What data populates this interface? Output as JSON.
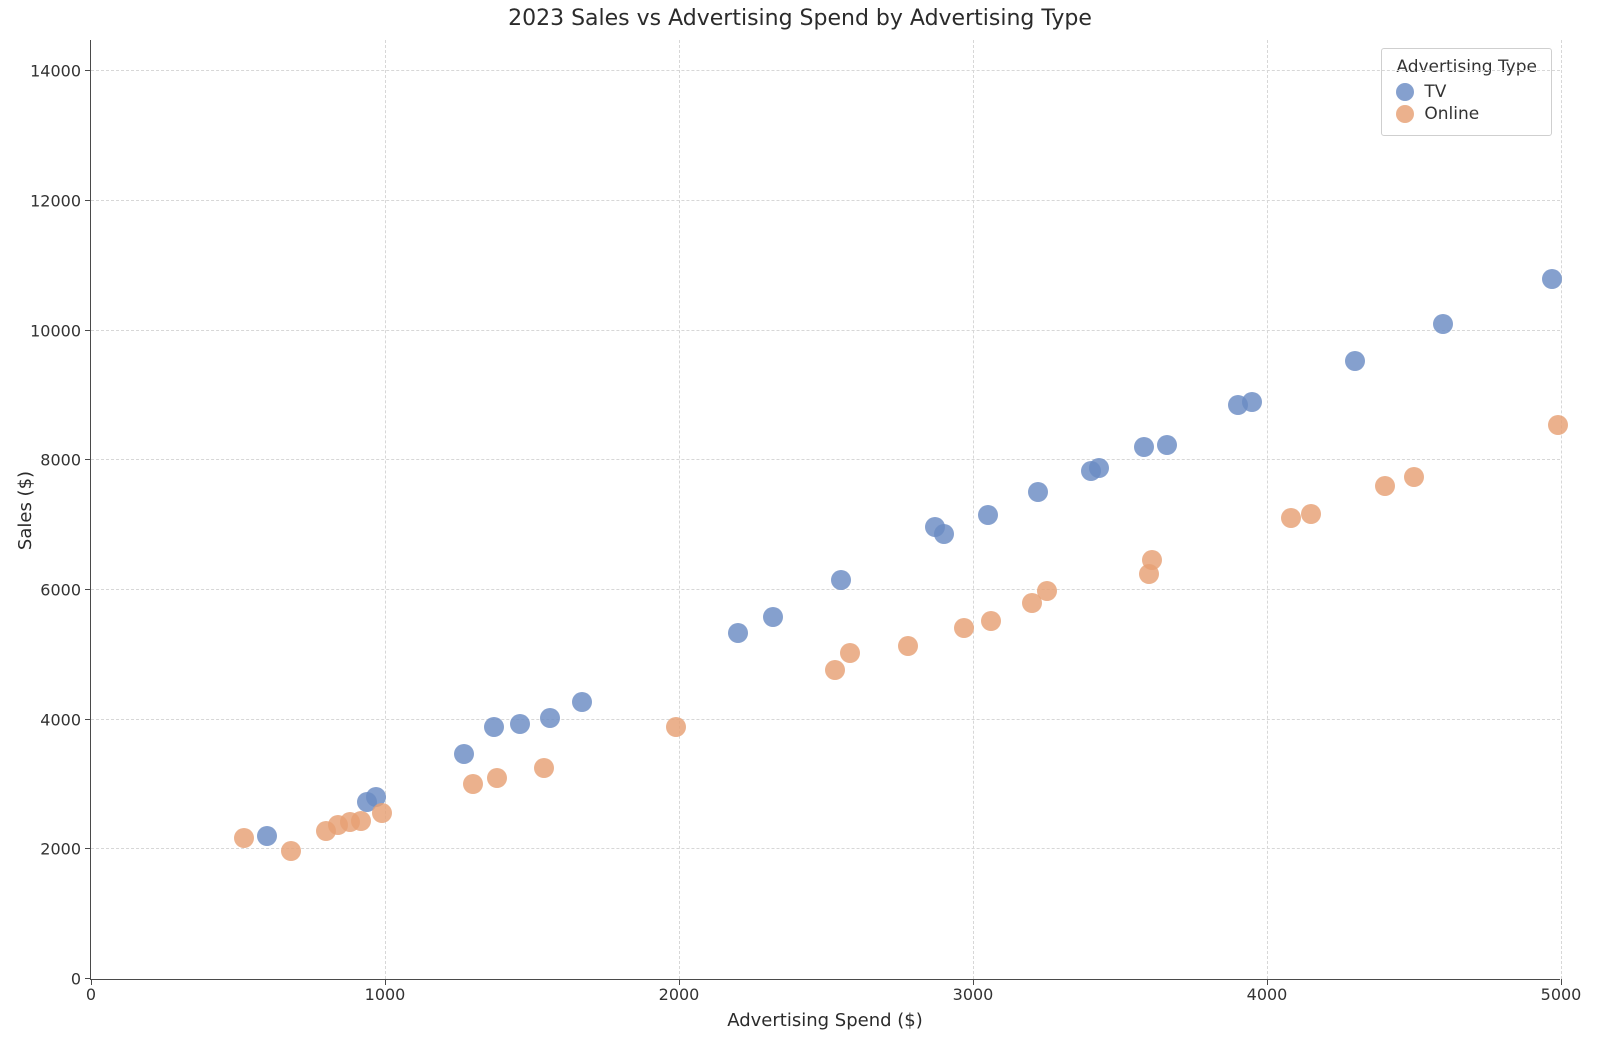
{
  "chart_data": {
    "type": "scatter",
    "title": "2023 Sales vs Advertising Spend by Advertising Type",
    "xlabel": "Advertising Spend ($)",
    "ylabel": "Sales ($)",
    "xlim": [
      0,
      5000
    ],
    "ylim": [
      0,
      14500
    ],
    "xticks": [
      0,
      1000,
      2000,
      3000,
      4000,
      5000
    ],
    "yticks": [
      0,
      2000,
      4000,
      6000,
      8000,
      10000,
      12000,
      14000
    ],
    "legend_title": "Advertising Type",
    "legend_position": "upper right",
    "grid": true,
    "colors": {
      "TV": "#6a8bc3",
      "Online": "#e6a074"
    },
    "series": [
      {
        "name": "TV",
        "points": [
          {
            "x": 600,
            "y": 2200
          },
          {
            "x": 940,
            "y": 2730
          },
          {
            "x": 970,
            "y": 2800
          },
          {
            "x": 1270,
            "y": 3470
          },
          {
            "x": 1370,
            "y": 3880
          },
          {
            "x": 1460,
            "y": 3930
          },
          {
            "x": 1560,
            "y": 4020
          },
          {
            "x": 1670,
            "y": 4270
          },
          {
            "x": 2200,
            "y": 5340
          },
          {
            "x": 2320,
            "y": 5580
          },
          {
            "x": 2550,
            "y": 6160
          },
          {
            "x": 2870,
            "y": 6980
          },
          {
            "x": 2900,
            "y": 6870
          },
          {
            "x": 3050,
            "y": 7160
          },
          {
            "x": 3220,
            "y": 7520
          },
          {
            "x": 3400,
            "y": 7830
          },
          {
            "x": 3430,
            "y": 7880
          },
          {
            "x": 3580,
            "y": 8200
          },
          {
            "x": 3660,
            "y": 8230
          },
          {
            "x": 3900,
            "y": 8850
          },
          {
            "x": 3950,
            "y": 8900
          },
          {
            "x": 4300,
            "y": 9530
          },
          {
            "x": 4600,
            "y": 10110
          },
          {
            "x": 4970,
            "y": 10800
          }
        ]
      },
      {
        "name": "Online",
        "points": [
          {
            "x": 520,
            "y": 2180
          },
          {
            "x": 680,
            "y": 1980
          },
          {
            "x": 800,
            "y": 2290
          },
          {
            "x": 840,
            "y": 2370
          },
          {
            "x": 880,
            "y": 2420
          },
          {
            "x": 920,
            "y": 2430
          },
          {
            "x": 990,
            "y": 2560
          },
          {
            "x": 1300,
            "y": 3010
          },
          {
            "x": 1380,
            "y": 3100
          },
          {
            "x": 1540,
            "y": 3260
          },
          {
            "x": 1990,
            "y": 3880
          },
          {
            "x": 2530,
            "y": 4760
          },
          {
            "x": 2580,
            "y": 5030
          },
          {
            "x": 2780,
            "y": 5130
          },
          {
            "x": 2970,
            "y": 5420
          },
          {
            "x": 3060,
            "y": 5520
          },
          {
            "x": 3200,
            "y": 5800
          },
          {
            "x": 3250,
            "y": 5990
          },
          {
            "x": 3600,
            "y": 6250
          },
          {
            "x": 3610,
            "y": 6470
          },
          {
            "x": 4080,
            "y": 7110
          },
          {
            "x": 4150,
            "y": 7180
          },
          {
            "x": 4400,
            "y": 7610
          },
          {
            "x": 4500,
            "y": 7740
          },
          {
            "x": 4990,
            "y": 8550
          }
        ]
      }
    ]
  }
}
